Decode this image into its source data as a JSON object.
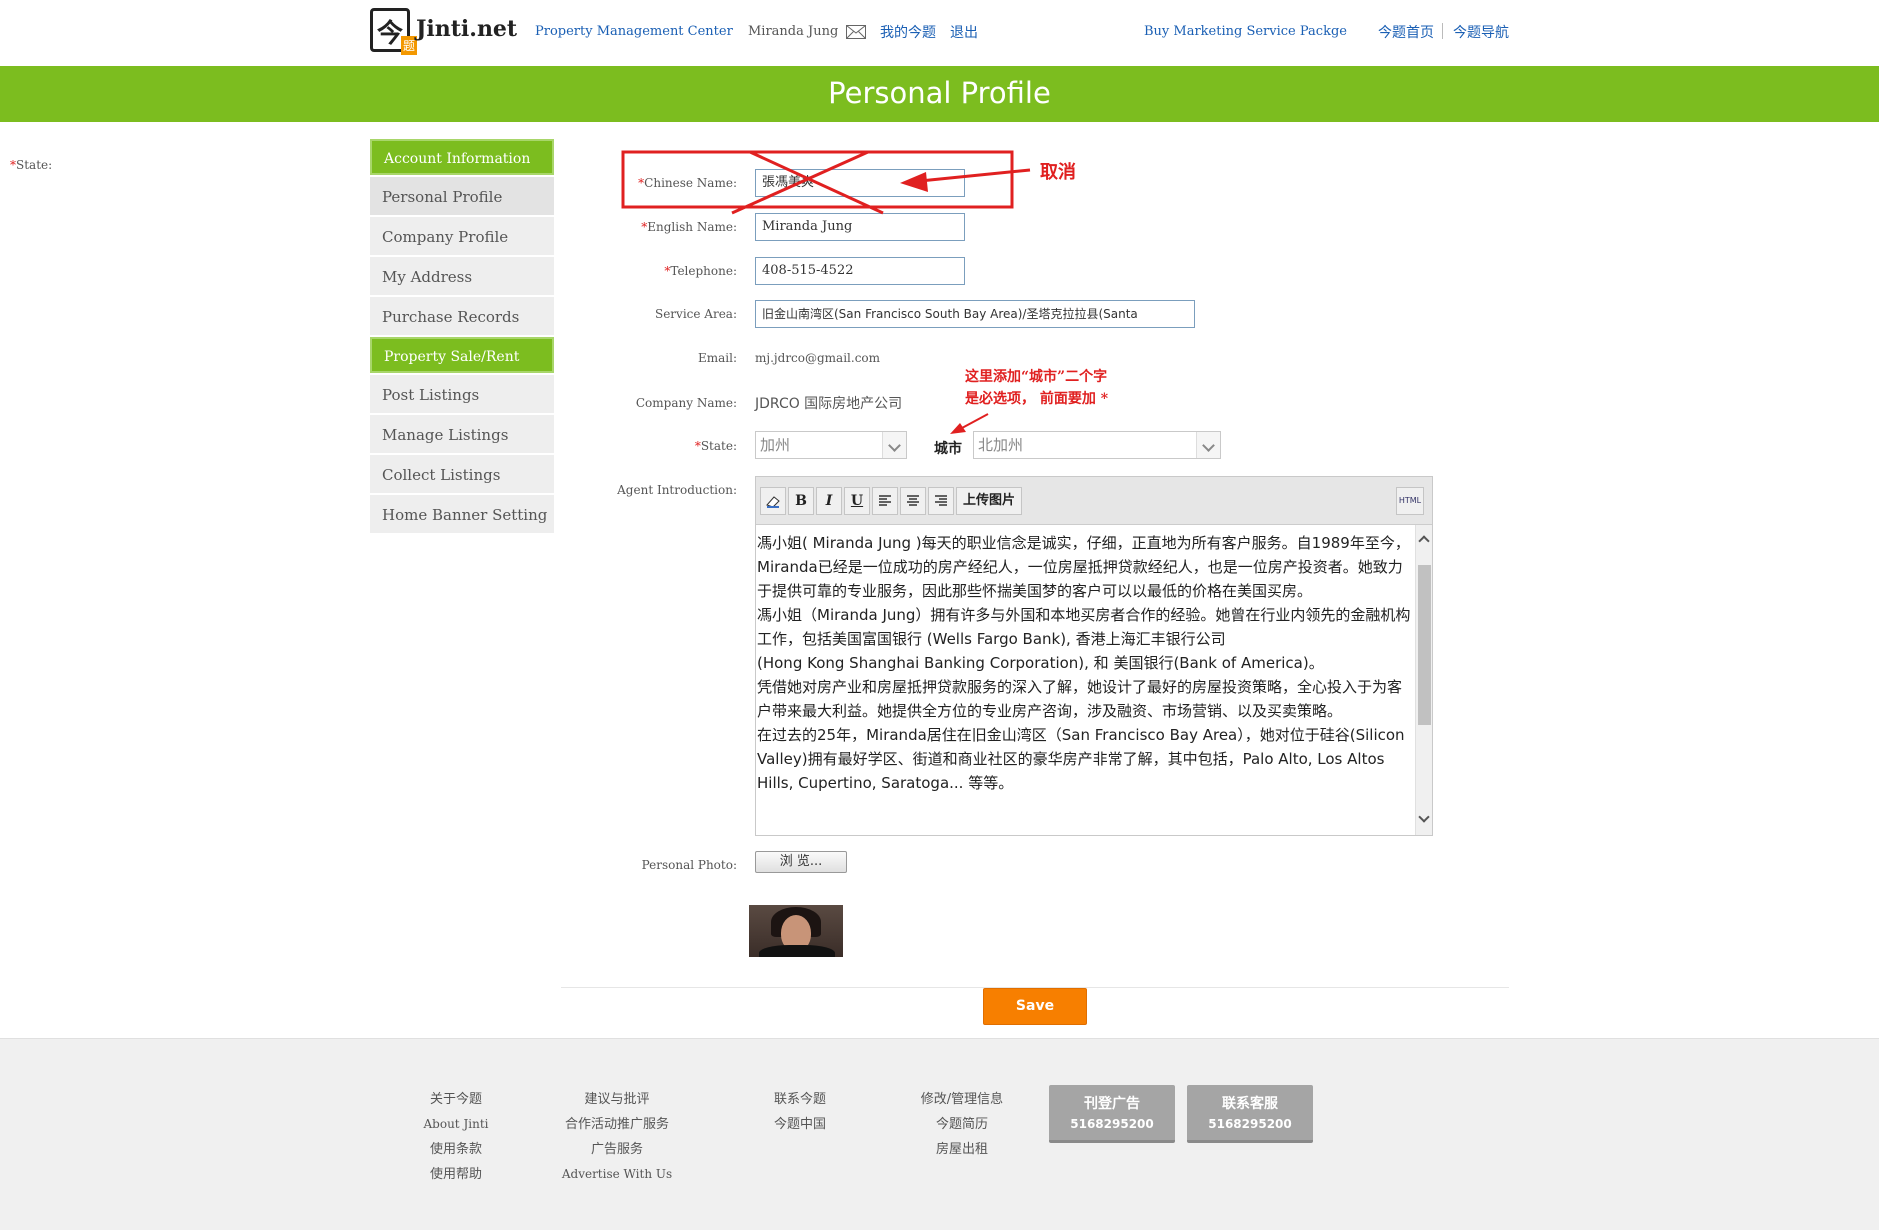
{
  "header": {
    "logo_char": "今",
    "logo_badge": "题",
    "logo_text": "Jinti.net",
    "nav_center": "Property Management Center",
    "user_name": "Miranda Jung",
    "my_jinti": "我的今题",
    "logout": "退出",
    "buy_marketing": "Buy Marketing Service Packge",
    "home": "今题首页",
    "navigation": "今题导航"
  },
  "banner": {
    "title": "Personal Profile"
  },
  "left_state_label": "State:",
  "sidebar": {
    "section1": "Account Information",
    "items1": [
      "Personal Profile",
      "Company Profile",
      "My Address",
      "Purchase Records"
    ],
    "section2": "Property Sale/Rent",
    "items2": [
      "Post Listings",
      "Manage Listings",
      "Collect Listings",
      "Home Banner Setting"
    ]
  },
  "form": {
    "chinese_name_label": "Chinese Name:",
    "chinese_name_value": "張馮美爽",
    "english_name_label": "English Name:",
    "english_name_value": "Miranda Jung",
    "telephone_label": "Telephone:",
    "telephone_value": "408-515-4522",
    "service_area_label": "Service Area:",
    "service_area_value": "旧金山南湾区(San Francisco South Bay Area)/圣塔克拉拉县(Santa",
    "email_label": "Email:",
    "email_value": "mj.jdrco@gmail.com",
    "company_name_label": "Company Name:",
    "company_name_value": "JDRCO 国际房地产公司",
    "state_label": "State:",
    "state_value": "加州",
    "city_label": "城市",
    "city_value": "北加州",
    "agent_intro_label": "Agent Introduction:",
    "personal_photo_label": "Personal Photo:",
    "browse_label": "浏 览...",
    "save_label": "Save"
  },
  "editor": {
    "toolbar": {
      "bold": "B",
      "italic": "I",
      "underline": "U",
      "upload": "上传图片",
      "html": "HTML"
    },
    "paragraphs": [
      "馮小姐( Miranda Jung )每天的职业信念是诚实，仔细，正直地为所有客户服务。自1989年至今，Miranda已经是一位成功的房产经纪人，一位房屋抵押贷款经纪人，也是一位房产投资者。她致力于提供可靠的专业服务，因此那些怀揣美国梦的客户可以以最低的价格在美国买房。",
      "馮小姐（Miranda Jung）拥有许多与外国和本地买房者合作的经验。她曾在行业内领先的金融机构工作，包括美国富国银行 (Wells Fargo Bank), 香港上海汇丰银行公司",
      "(Hong Kong Shanghai Banking Corporation), 和 美国银行(Bank of America)。",
      "凭借她对房产业和房屋抵押贷款服务的深入了解，她设计了最好的房屋投资策略，全心投入于为客户带来最大利益。她提供全方位的专业房产咨询，涉及融资、市场营销、以及买卖策略。",
      "在过去的25年，Miranda居住在旧金山湾区（San Francisco Bay Area），她对位于硅谷(Silicon Valley)拥有最好学区、街道和商业社区的豪华房产非常了解，其中包括，Palo Alto, Los Altos Hills, Cupertino, Saratoga... 等等。"
    ]
  },
  "annotations": {
    "cancel": "取消",
    "city_note_line1": "这里添加“城市”二个字",
    "city_note_line2": "是必选项， 前面要加 *"
  },
  "footer": {
    "col1": [
      "关于今题",
      "About Jinti",
      "使用条款",
      "使用帮助"
    ],
    "col2": [
      "建议与批评",
      "合作活动推广服务",
      "广告服务",
      "Advertise With Us"
    ],
    "col3": [
      "联系今题",
      "今题中国"
    ],
    "col4": [
      "修改/管理信息",
      "今题简历",
      "房屋出租"
    ],
    "btn_ads": {
      "title": "刊登广告",
      "phone": "5168295200"
    },
    "btn_service": {
      "title": "联系客服",
      "phone": "5168295200"
    }
  },
  "colors": {
    "green": "#7cbd1f",
    "orange": "#f77f00",
    "annotation_red": "#e02020",
    "link_blue": "#1a5fb4"
  },
  "icons": [
    "mail-icon",
    "eraser-icon",
    "align-left-icon",
    "align-center-icon",
    "align-right-icon",
    "html-icon",
    "chevron-down-icon"
  ]
}
